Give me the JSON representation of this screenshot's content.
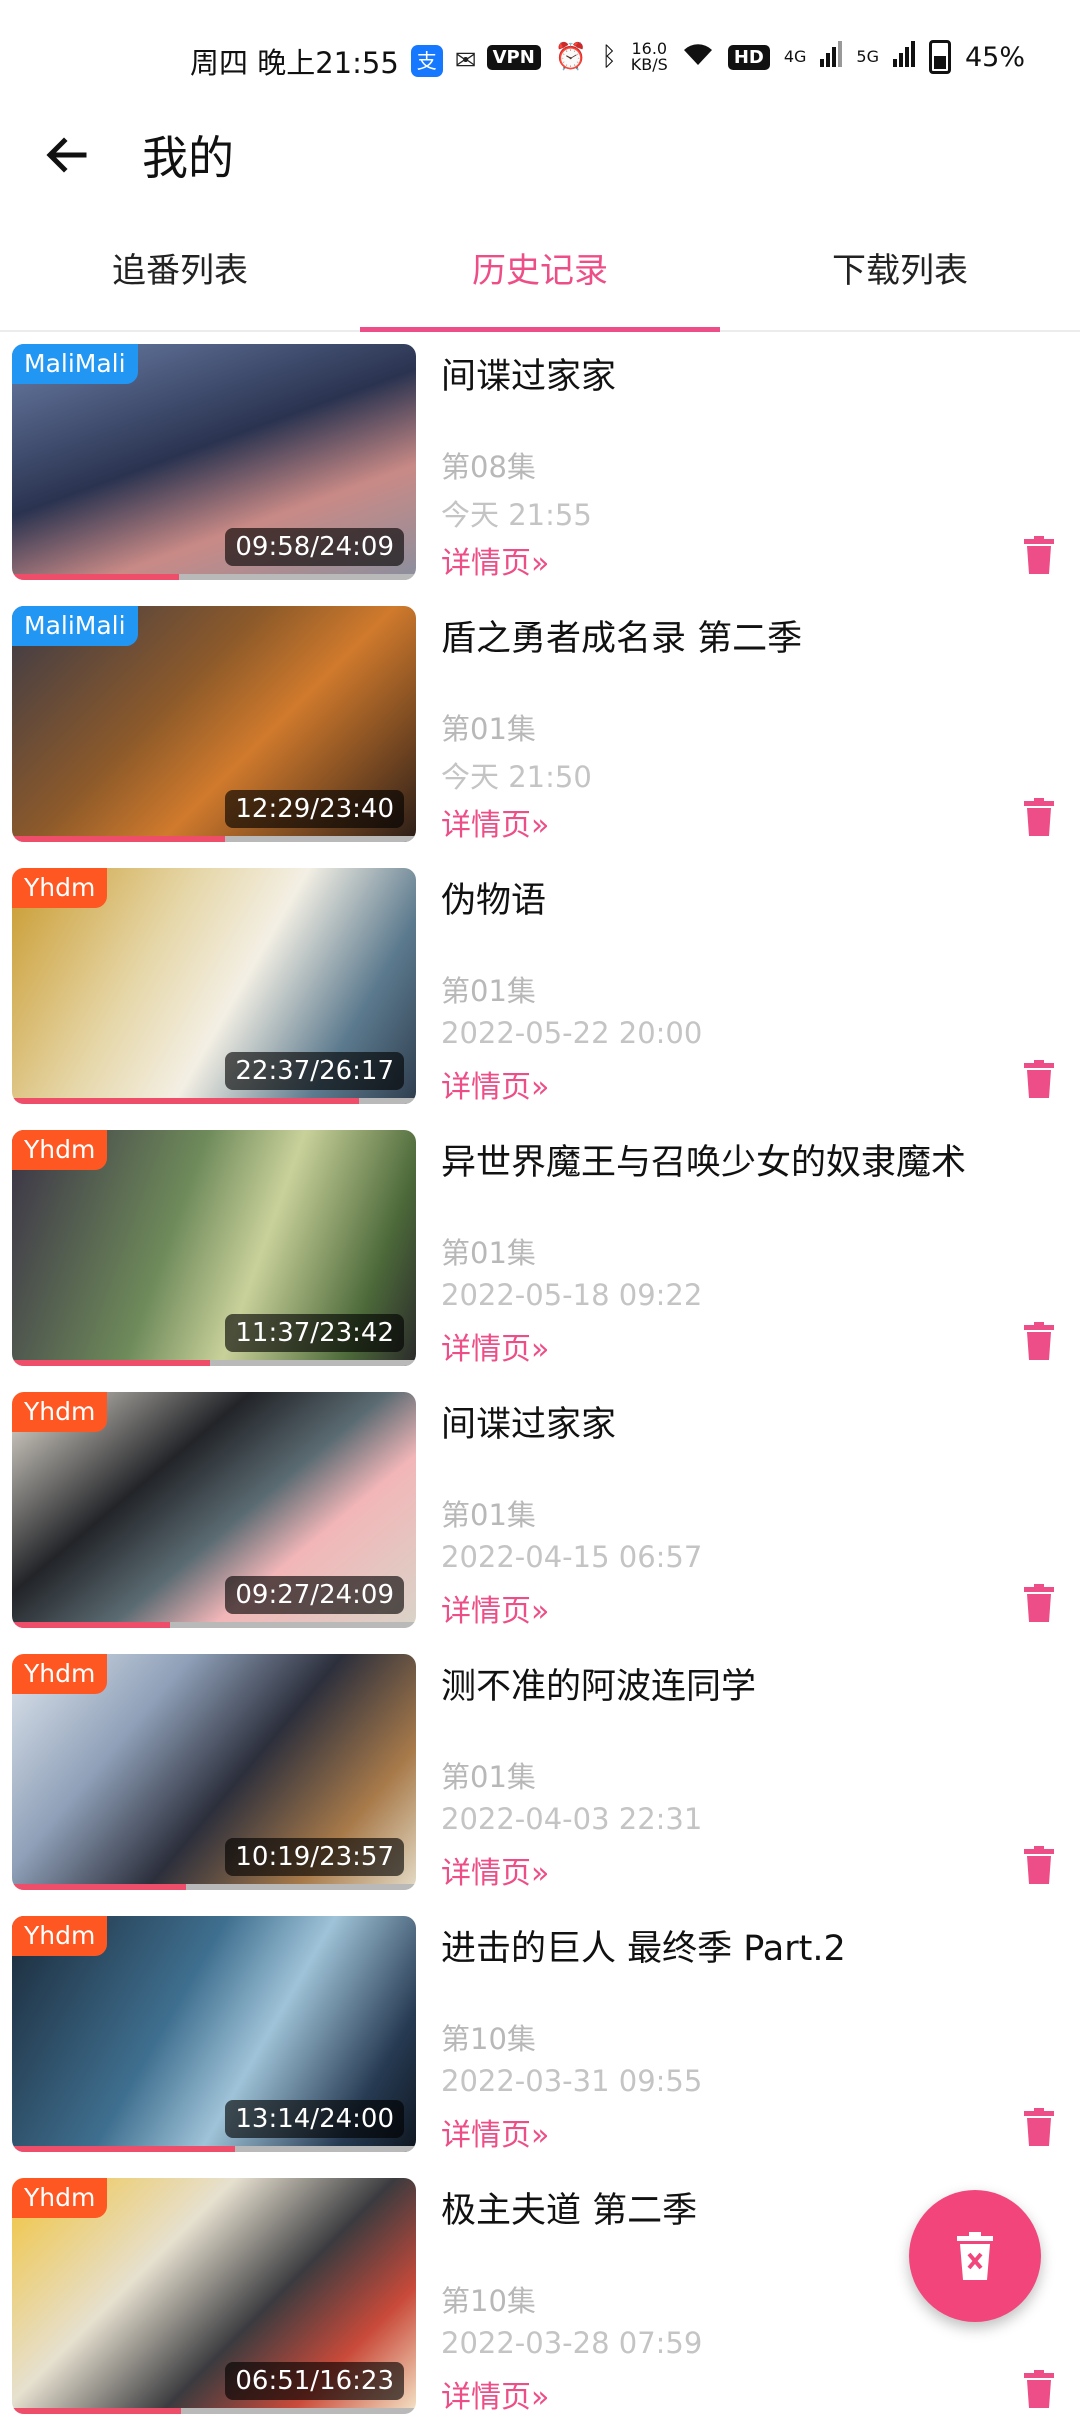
{
  "status_bar": {
    "time": "周四 晚上21:55",
    "vpn": "VPN",
    "speed_value": "16.0",
    "speed_unit": "KB/S",
    "hd": "HD",
    "net1": "4G",
    "net2": "5G",
    "battery": "45%"
  },
  "app_bar": {
    "title": "我的"
  },
  "tabs": [
    {
      "label": "追番列表",
      "active": false
    },
    {
      "label": "历史记录",
      "active": true
    },
    {
      "label": "下载列表",
      "active": false
    }
  ],
  "history": [
    {
      "title": "间谍过家家",
      "episode": "第08集",
      "date": "今天 21:55",
      "detail": "详情页»",
      "source": "MaliMali",
      "time": "09:58/24:09",
      "progress": 0.413
    },
    {
      "title": "盾之勇者成名录 第二季",
      "episode": "第01集",
      "date": "今天 21:50",
      "detail": "详情页»",
      "source": "MaliMali",
      "time": "12:29/23:40",
      "progress": 0.528
    },
    {
      "title": "伪物语",
      "episode": "第01集",
      "date": "2022-05-22 20:00",
      "detail": "详情页»",
      "source": "Yhdm",
      "time": "22:37/26:17",
      "progress": 0.86
    },
    {
      "title": "异世界魔王与召唤少女的奴隶魔术",
      "episode": "第01集",
      "date": "2022-05-18 09:22",
      "detail": "详情页»",
      "source": "Yhdm",
      "time": "11:37/23:42",
      "progress": 0.49
    },
    {
      "title": "间谍过家家",
      "episode": "第01集",
      "date": "2022-04-15 06:57",
      "detail": "详情页»",
      "source": "Yhdm",
      "time": "09:27/24:09",
      "progress": 0.391
    },
    {
      "title": "测不准的阿波连同学",
      "episode": "第01集",
      "date": "2022-04-03 22:31",
      "detail": "详情页»",
      "source": "Yhdm",
      "time": "10:19/23:57",
      "progress": 0.431
    },
    {
      "title": "进击的巨人 最终季 Part.2",
      "episode": "第10集",
      "date": "2022-03-31 09:55",
      "detail": "详情页»",
      "source": "Yhdm",
      "time": "13:14/24:00",
      "progress": 0.551
    },
    {
      "title": "极主夫道 第二季",
      "episode": "第10集",
      "date": "2022-03-28 07:59",
      "detail": "详情页»",
      "source": "Yhdm",
      "time": "06:51/16:23",
      "progress": 0.418
    }
  ],
  "colors": {
    "accent": "#ee4e87",
    "fab": "#f2457c",
    "badge_malimali": "#2196f3",
    "badge_yhdm": "#ff5722",
    "progress": "#ee4e6a"
  },
  "icons": {
    "back": "arrow-left-icon",
    "delete": "trash-icon",
    "fab": "clear-all-trash-icon"
  }
}
